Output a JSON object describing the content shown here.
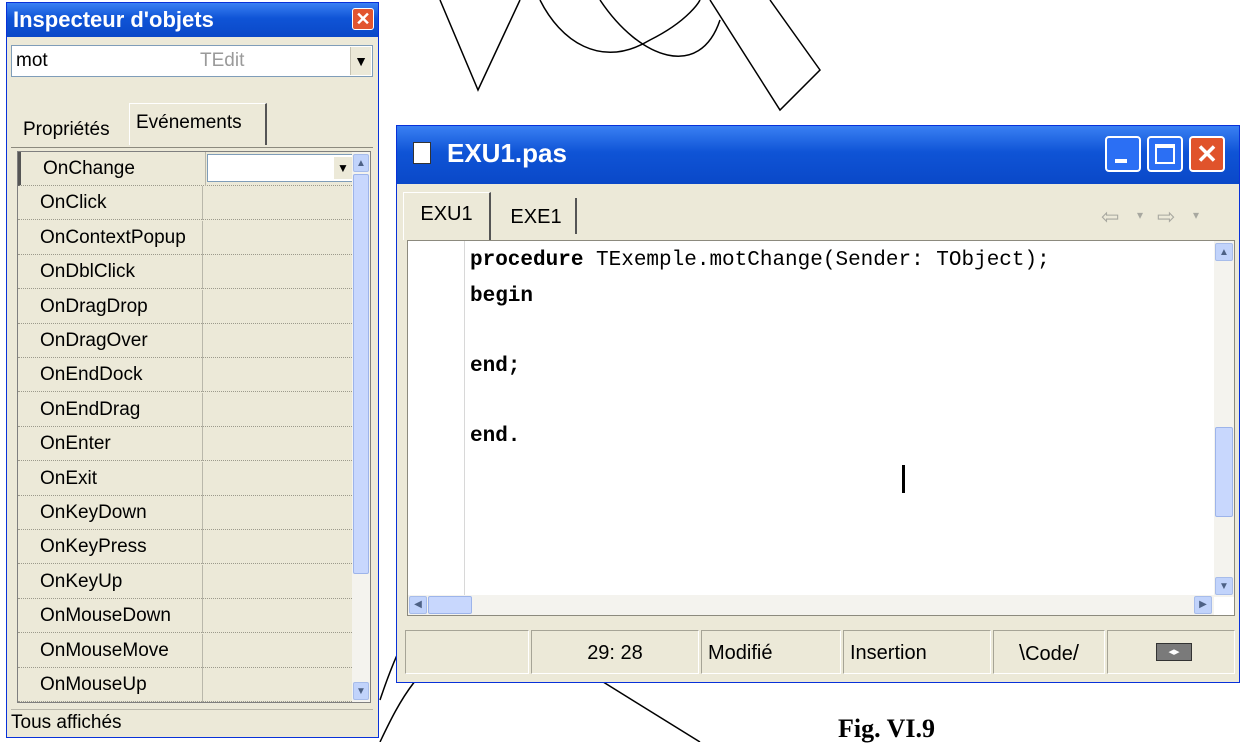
{
  "inspector": {
    "title": "Inspecteur d'objets",
    "close_glyph": "✕",
    "object_name": "mot",
    "object_type": "TEdit",
    "tabs": [
      {
        "label": "Propriétés"
      },
      {
        "label": "Evénements"
      }
    ],
    "events": [
      "OnChange",
      "OnClick",
      "OnContextPopup",
      "OnDblClick",
      "OnDragDrop",
      "OnDragOver",
      "OnEndDock",
      "OnEndDrag",
      "OnEnter",
      "OnExit",
      "OnKeyDown",
      "OnKeyPress",
      "OnKeyUp",
      "OnMouseDown",
      "OnMouseMove",
      "OnMouseUp"
    ],
    "status": "Tous affichés"
  },
  "editor": {
    "title": "EXU1.pas",
    "tabs": [
      {
        "label": "EXU1"
      },
      {
        "label": "EXE1"
      }
    ],
    "code": {
      "line1_kw": "procedure",
      "line1_rest": " TExemple.motChange(Sender: TObject);",
      "line2": "begin",
      "line3": "end;",
      "line4": "end."
    },
    "status": {
      "position": "29:  28",
      "modified": "Modifié",
      "mode": "Insertion",
      "view_tab": "Code"
    }
  },
  "caption": "Fig. VI.9",
  "colors": {
    "titlebar": "#0f54d6",
    "window_face": "#ece9d8",
    "close_red": "#e0532b"
  }
}
